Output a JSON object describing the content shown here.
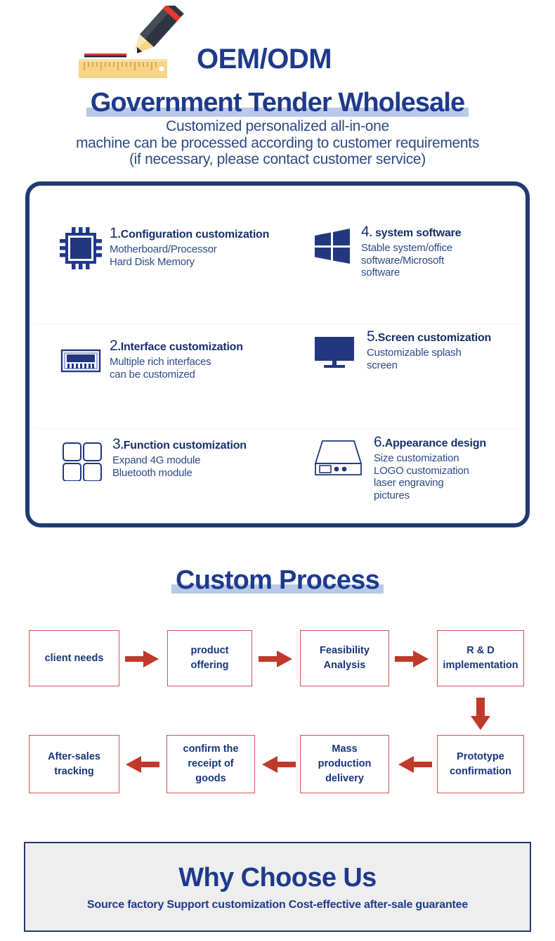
{
  "hero": {
    "logo_icon": "pencil-ruler-icon",
    "title": "OEM/ODM",
    "subtitle": "Government Tender Wholesale",
    "lines": [
      "Customized personalized all-in-one",
      "machine can be processed according to customer requirements",
      "(if necessary, please contact customer service)"
    ],
    "highlight_color": "#b9c9ea",
    "text_color": "#1e3a8c"
  },
  "features": {
    "border_color": "#1f3a73",
    "items": [
      {
        "number": "1",
        "title": ".Configuration customization",
        "desc": "Motherboard/Processor\nHard Disk Memory",
        "icon": "cpu-chip-icon"
      },
      {
        "number": "2",
        "title": ".Interface customization",
        "desc": "Multiple rich interfaces\ncan be customized",
        "icon": "io-port-icon"
      },
      {
        "number": "3",
        "title": ".Function customization",
        "desc": "Expand 4G module\nBluetooth module",
        "icon": "modules-grid-icon"
      },
      {
        "number": "4",
        "title": ". system software",
        "desc": "Stable system/office\nsoftware/Microsoft\nsoftware",
        "icon": "windows-logo-icon"
      },
      {
        "number": "5",
        "title": ".Screen customization",
        "desc": "Customizable splash\nscreen",
        "icon": "monitor-icon"
      },
      {
        "number": "6",
        "title": ".Appearance design",
        "desc": "Size customization\nLOGO customization\n laser engraving\n pictures",
        "icon": "chassis-case-icon"
      }
    ]
  },
  "process": {
    "title": "Custom Process",
    "box_border_color": "#d0564f",
    "arrow_color": "#c0392b",
    "steps_row1": [
      "client needs",
      "product\noffering",
      "Feasibility\nAnalysis",
      "R & D\nimplementation"
    ],
    "steps_row2": [
      "Prototype\nconfirmation",
      "Mass\nproduction\ndelivery",
      "confirm the\nreceipt of\ngoods",
      "After-sales\ntracking"
    ]
  },
  "why": {
    "title": "Why Choose Us",
    "subtitle": "Source factory Support customization Cost-effective after-sale guarantee",
    "background": "#eeeeee",
    "border_color": "#1f3a73"
  }
}
